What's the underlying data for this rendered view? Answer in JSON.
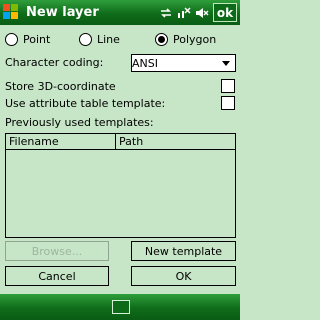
{
  "titlebar": {
    "title": "New layer",
    "ok_label": "ok",
    "icons": [
      "windows-start-icon",
      "connectivity-icon",
      "signal-off-icon",
      "volume-mute-icon"
    ]
  },
  "geometry": {
    "options": [
      "Point",
      "Line",
      "Polygon"
    ],
    "selected": "Polygon"
  },
  "coding": {
    "label": "Character coding:",
    "value": "ANSI"
  },
  "options": {
    "store3d_label": "Store 3D-coordinate",
    "store3d_checked": false,
    "attr_template_label": "Use attribute table template:",
    "attr_template_checked": false
  },
  "templates": {
    "label": "Previously used templates:",
    "columns": [
      "Filename",
      "Path"
    ],
    "rows": []
  },
  "buttons": {
    "browse": "Browse...",
    "new_template": "New template",
    "cancel": "Cancel",
    "ok": "OK"
  },
  "bottombar": {
    "icon": "keyboard-icon"
  },
  "colors": {
    "bar_green": "#0f6c1a",
    "background": "#c7e6c7"
  }
}
